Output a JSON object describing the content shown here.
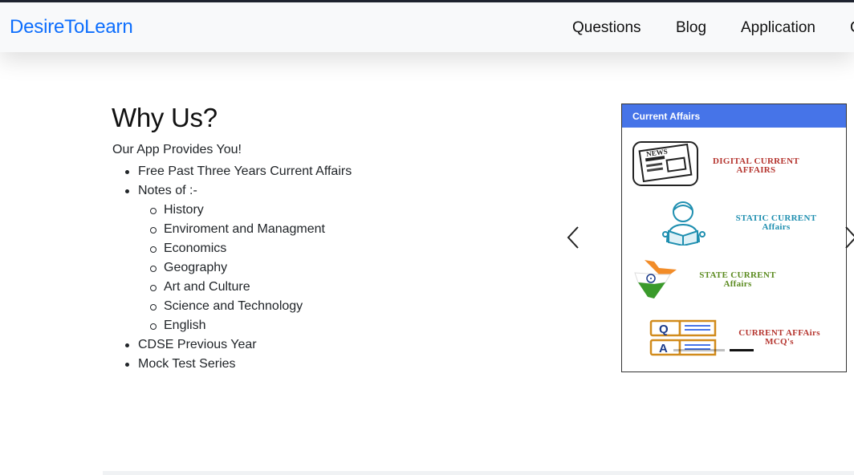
{
  "navbar": {
    "brand": "DesireToLearn",
    "links": [
      {
        "label": "Questions"
      },
      {
        "label": "Blog"
      },
      {
        "label": "Application"
      },
      {
        "label": "C"
      }
    ]
  },
  "why": {
    "title": "Why Us?",
    "intro": "Our App Provides You!",
    "items": [
      {
        "label": "Free Past Three Years Current Affairs"
      },
      {
        "label": "Notes of :-",
        "sub": [
          "History",
          "Enviroment and Managment",
          "Economics",
          "Geography",
          "Art and Culture",
          "Science and Technology",
          "English"
        ]
      },
      {
        "label": "CDSE Previous Year"
      },
      {
        "label": "Mock Test Series"
      }
    ]
  },
  "carousel": {
    "app_header": "Current Affairs",
    "rows": [
      {
        "line1": "DIGITAL CURRENT",
        "line2": "AFFAIRS",
        "color": "#b5352f"
      },
      {
        "line1": "STATIC CURRENT",
        "line2": "Affairs",
        "color": "#1f8fb0"
      },
      {
        "line1": "STATE CURRENT",
        "line2": "Affairs",
        "color": "#5a8a1e"
      },
      {
        "line1": "CURRENT AFFAirs",
        "line2": "MCQ's",
        "color": "#b5352f"
      }
    ],
    "newspaper_label": "NEWS",
    "qa_labels": [
      "Q",
      "A"
    ],
    "active_slide": 2,
    "slide_count": 2
  },
  "colors": {
    "brand": "#0d6efd",
    "app_header": "#4674e8"
  }
}
